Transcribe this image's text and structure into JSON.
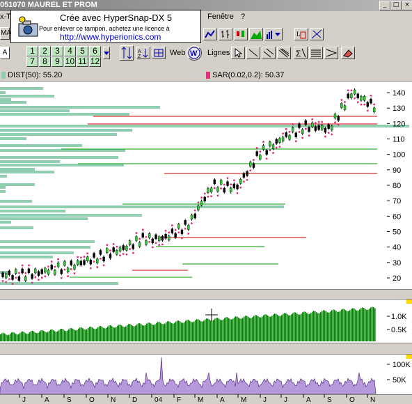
{
  "window": {
    "title": "051070  MAUREL ET PROM",
    "min": "_",
    "max": "□",
    "close": "×"
  },
  "menu": {
    "left_fragment": "x·Te",
    "window_label": "Fenêtre",
    "help_label": "?"
  },
  "stamp": {
    "line1": "Crée avec HyperSnap-DX 5",
    "line2": "Pour enlever ce tampon, achetez une licence à",
    "line3": "http://www.hyperionics.com"
  },
  "toolbar1": {
    "left_fragment": "MA"
  },
  "toolbar2": {
    "period_label": "A",
    "period_buttons": [
      "1",
      "2",
      "3",
      "4",
      "5",
      "6",
      "7",
      "8",
      "9",
      "10",
      "11",
      "12"
    ],
    "web_label": "Web",
    "lines_label": "Lignes"
  },
  "indicators": {
    "dist_label": "DIST(50): 55.20",
    "sar_label": "SAR(0.02,0.2): 50.37",
    "sar_color": "#e0307a",
    "dist_color": "#8fcfb0"
  },
  "price_axis": [
    "140",
    "130",
    "120",
    "110",
    "100",
    "90",
    "80",
    "70",
    "60",
    "50",
    "40",
    "30",
    "20"
  ],
  "volume_axis": [
    "1.0K",
    "0.5K"
  ],
  "osc_axis": [
    "100K",
    "50K"
  ],
  "months": [
    "J",
    "A",
    "S",
    "O",
    "N",
    "D",
    "04",
    "F",
    "M",
    "A",
    "M",
    "J",
    "J",
    "A",
    "S",
    "O",
    "N"
  ],
  "chart_data": {
    "type": "line",
    "title": "051070 MAUREL ET PROM",
    "months": [
      "J",
      "A",
      "S",
      "O",
      "N",
      "D",
      "04",
      "F",
      "M",
      "A",
      "M",
      "J",
      "J",
      "A",
      "S",
      "O",
      "N"
    ],
    "price_monthly_approx": [
      22,
      22,
      25,
      28,
      33,
      38,
      45,
      46,
      55,
      80,
      78,
      100,
      110,
      118,
      116,
      140,
      130
    ],
    "ylim": [
      15,
      145
    ],
    "series": [
      {
        "name": "DIST(50)",
        "value_last": 55.2
      },
      {
        "name": "SAR(0.02,0.2)",
        "value_last": 50.37
      }
    ]
  }
}
